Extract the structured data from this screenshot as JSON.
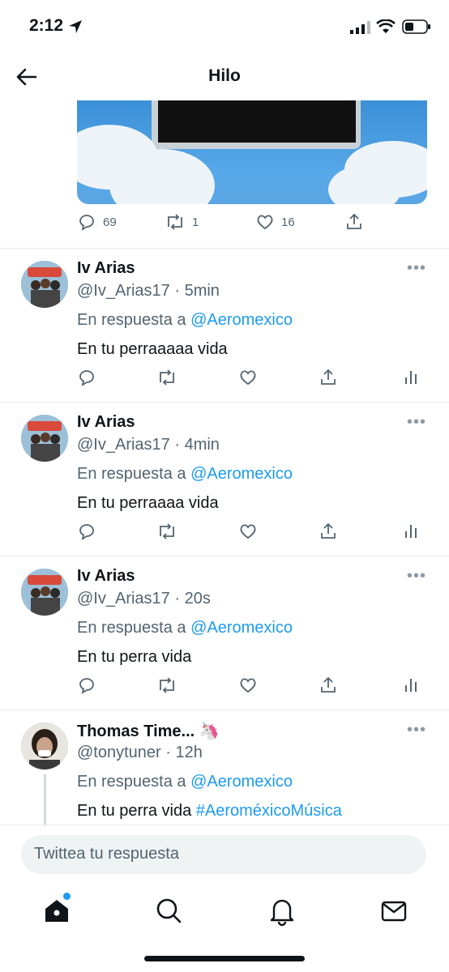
{
  "status": {
    "time": "2:12"
  },
  "header": {
    "title": "Hilo"
  },
  "top_tweet_actions": {
    "replies": "69",
    "retweets": "1",
    "likes": "16"
  },
  "tweets": [
    {
      "name": "Iv Arias",
      "handle": "@Iv_Arias17 · 5min",
      "reply_prefix": "En respuesta a",
      "reply_to": "@Aeromexico",
      "text": "En tu perraaaaa vida"
    },
    {
      "name": "Iv Arias",
      "handle": "@Iv_Arias17 · 4min",
      "reply_prefix": "En respuesta a",
      "reply_to": "@Aeromexico",
      "text": "En tu perraaaa vida"
    },
    {
      "name": "Iv Arias",
      "handle": "@Iv_Arias17 · 20s",
      "reply_prefix": "En respuesta a",
      "reply_to": "@Aeromexico",
      "text": "En tu perra vida"
    },
    {
      "name": "Thomas Time... 🦄",
      "handle": "@tonytuner · 12h",
      "reply_prefix": "En respuesta a",
      "reply_to": "@Aeromexico",
      "text": "En tu perra vida",
      "hashtag": "#AeroméxicoMúsica"
    }
  ],
  "composer": {
    "placeholder": "Twittea tu respuesta"
  },
  "colors": {
    "accent": "#1d9bf0",
    "text": "#0f1419",
    "muted": "#536471"
  },
  "icons": [
    "back-arrow-icon",
    "reply-icon",
    "retweet-icon",
    "like-icon",
    "share-icon",
    "analytics-icon",
    "home-icon",
    "search-icon",
    "bell-icon",
    "mail-icon"
  ]
}
